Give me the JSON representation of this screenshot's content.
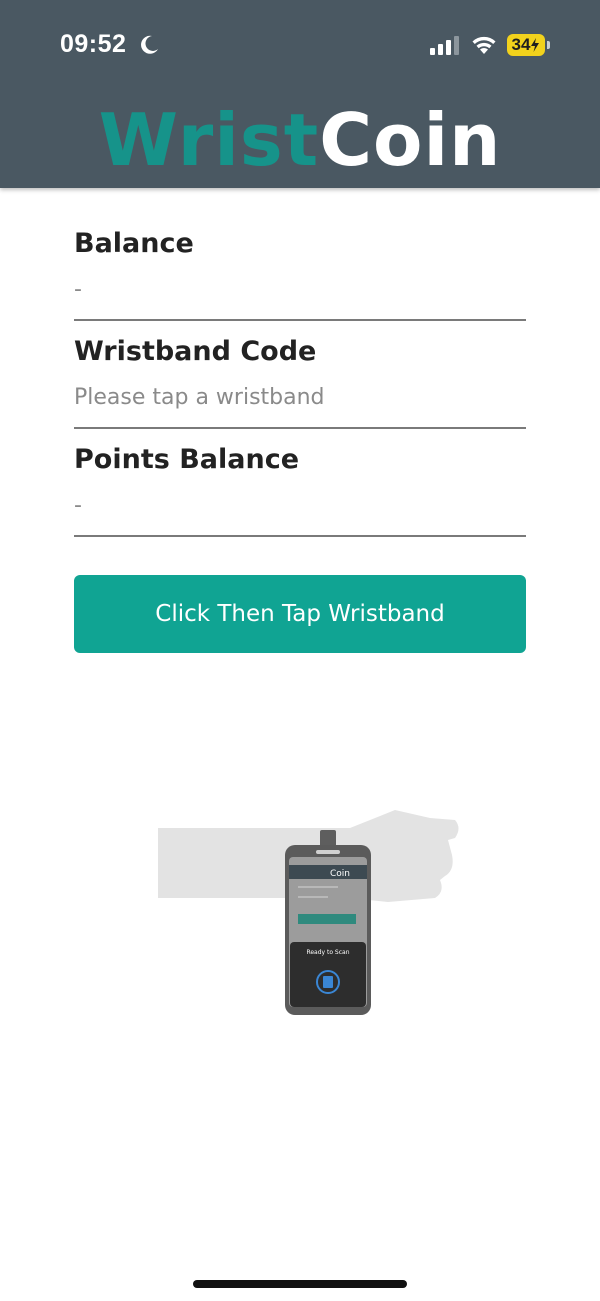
{
  "status_bar": {
    "time": "09:52",
    "battery_level": "34",
    "icons": [
      "moon-icon",
      "cellular-signal-icon",
      "wifi-icon",
      "battery-charging-icon"
    ]
  },
  "header": {
    "logo_part1": "Wrist",
    "logo_part2": "Coin",
    "background_color": "#4a5862",
    "brand_color": "#16938a"
  },
  "fields": {
    "balance": {
      "label": "Balance",
      "value": "-"
    },
    "wristband_code": {
      "label": "Wristband Code",
      "placeholder": "Please tap a wristband"
    },
    "points_balance": {
      "label": "Points Balance",
      "value": "-"
    }
  },
  "action": {
    "button_label": "Click Then Tap Wristband",
    "button_color": "#10a493"
  },
  "illustration": {
    "phone_logo": "Coin",
    "scan_title": "Ready to Scan",
    "icon": "nfc-scan-icon"
  }
}
